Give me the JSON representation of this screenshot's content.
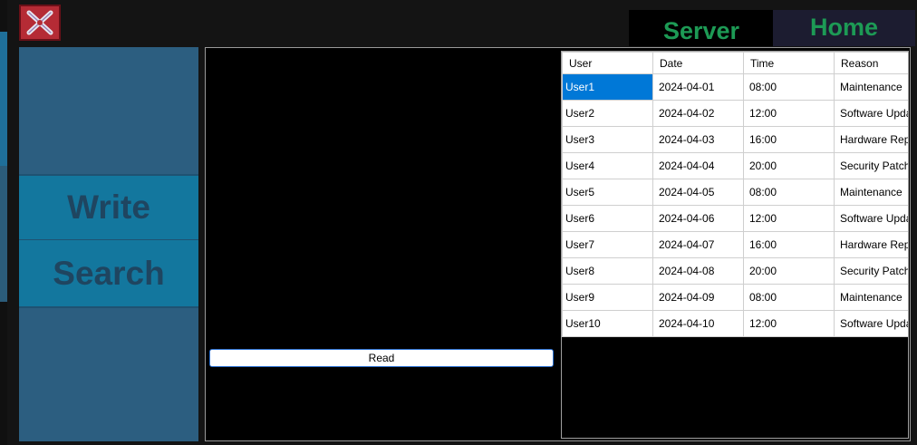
{
  "tabs": {
    "server": "Server",
    "home": "Home"
  },
  "sidebar": {
    "write_label": "Write",
    "search_label": "Search"
  },
  "read_button": "Read",
  "colors": {
    "accent": "#1d9a55",
    "sidebar": "#2c5e80",
    "sidebar_button": "#13779e",
    "selection": "#0078d7"
  },
  "table": {
    "columns": [
      "User",
      "Date",
      "Time",
      "Reason"
    ],
    "selected": {
      "row": 0,
      "column": 0
    },
    "rows": [
      [
        "User1",
        "2024-04-01",
        "08:00",
        "Maintenance"
      ],
      [
        "User2",
        "2024-04-02",
        "12:00",
        "Software Upda"
      ],
      [
        "User3",
        "2024-04-03",
        "16:00",
        "Hardware Repl"
      ],
      [
        "User4",
        "2024-04-04",
        "20:00",
        "Security Patch"
      ],
      [
        "User5",
        "2024-04-05",
        "08:00",
        "Maintenance"
      ],
      [
        "User6",
        "2024-04-06",
        "12:00",
        "Software Upda"
      ],
      [
        "User7",
        "2024-04-07",
        "16:00",
        "Hardware Repl"
      ],
      [
        "User8",
        "2024-04-08",
        "20:00",
        "Security Patch"
      ],
      [
        "User9",
        "2024-04-09",
        "08:00",
        "Maintenance"
      ],
      [
        "User10",
        "2024-04-10",
        "12:00",
        "Software Upda"
      ]
    ]
  }
}
